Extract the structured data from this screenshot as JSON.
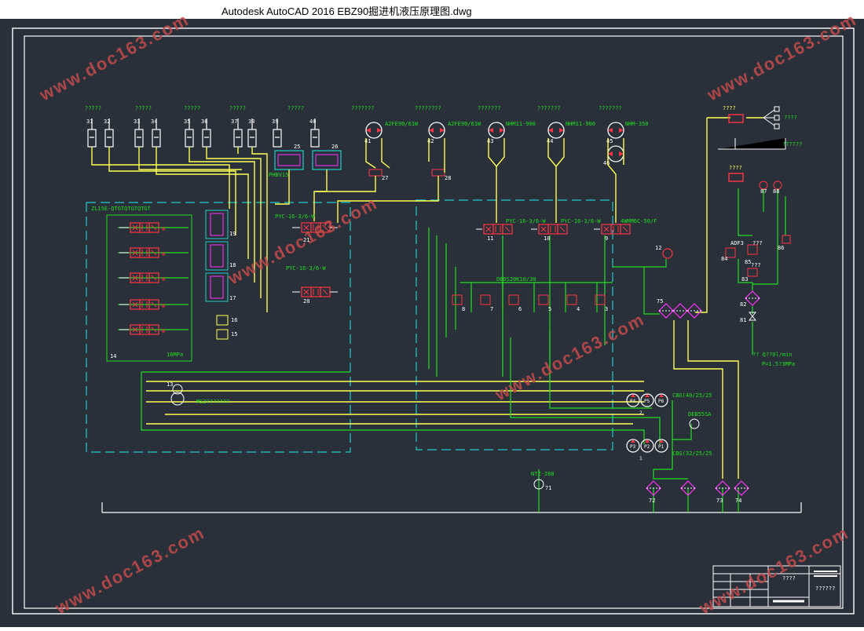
{
  "window": {
    "title": "Autodesk AutoCAD 2016     EBZ90掘进机液压原理图.dwg"
  },
  "watermark": "www.doc163.com",
  "labels": {
    "top_groups": [
      "?????",
      "?????",
      "?????",
      "?????",
      "?????",
      "???????",
      "????????",
      "???????",
      "???????",
      "???????"
    ],
    "cyl_nums": [
      "31",
      "32",
      "33",
      "34",
      "35",
      "36",
      "37",
      "38",
      "39",
      "40"
    ],
    "valves_25_26": [
      "25",
      "26"
    ],
    "ph": "PHBV15",
    "motor41": "A2FE90/61W",
    "motor42": "A2FE90/61W",
    "motor43": "NHM11-900",
    "motor44": "NHM11-900",
    "motor45": "NHM-350",
    "n41": "41",
    "n42": "42",
    "n43": "43",
    "n44": "44",
    "n45": "45",
    "n46": "46",
    "n27": "27",
    "n28": "28",
    "zl": "ZL15E-QTGTQTGTQTGT",
    "pyc1": "PYC-16-3/6-W",
    "pyc2": "PYC-16-3/6-W",
    "pyc3": "PYC-16-3/6-W",
    "pyc4": "PYC-16-3/6-W",
    "four": "4WMM6C-50/F",
    "n21": "21",
    "n20": "20",
    "n11": "11",
    "n10": "10",
    "n9": "9",
    "n12": "12",
    "dbds": "DBDS20K10/30",
    "relief_nums": [
      "8",
      "7",
      "6",
      "5",
      "4",
      "3"
    ],
    "n19": "19",
    "n18": "18",
    "n17": "17",
    "n16": "16",
    "n15": "15",
    "n14": "14",
    "mpa16": "16MPa",
    "n13": "13",
    "ms": "MS2???????",
    "cbg1": "CBG(40/25/25",
    "cbg2": "CBG(32/25/25",
    "p4": "P4",
    "p5": "P5",
    "p6": "P6",
    "p3": "P3",
    "p2": "P2",
    "p1": "P1",
    "n1": "1",
    "n2": "2",
    "deb": "DEB55SA",
    "ntz": "NTZ-288",
    "n71": "71",
    "n72": "72",
    "n73": "73",
    "n74": "74",
    "n75": "75",
    "r84": "84",
    "r85": "85",
    "r86": "86",
    "r83": "83",
    "r82": "82",
    "r81": "81",
    "r87": "87",
    "r88": "88",
    "adf": "ADF3",
    "q": "?? Q??0l/min",
    "pval": "P=1.5?3MPa",
    "qq1": "????",
    "qq2": "????",
    "qq3": "??????",
    "qq4": "???",
    "qq5": "???",
    "tb1": "????",
    "tb2": "??????"
  },
  "colors": {
    "yellow": "#ffff55",
    "green": "#22dd22",
    "red": "#ff3344",
    "magenta": "#ff33ff",
    "cyan": "#22cccc",
    "white": "#ffffff"
  }
}
